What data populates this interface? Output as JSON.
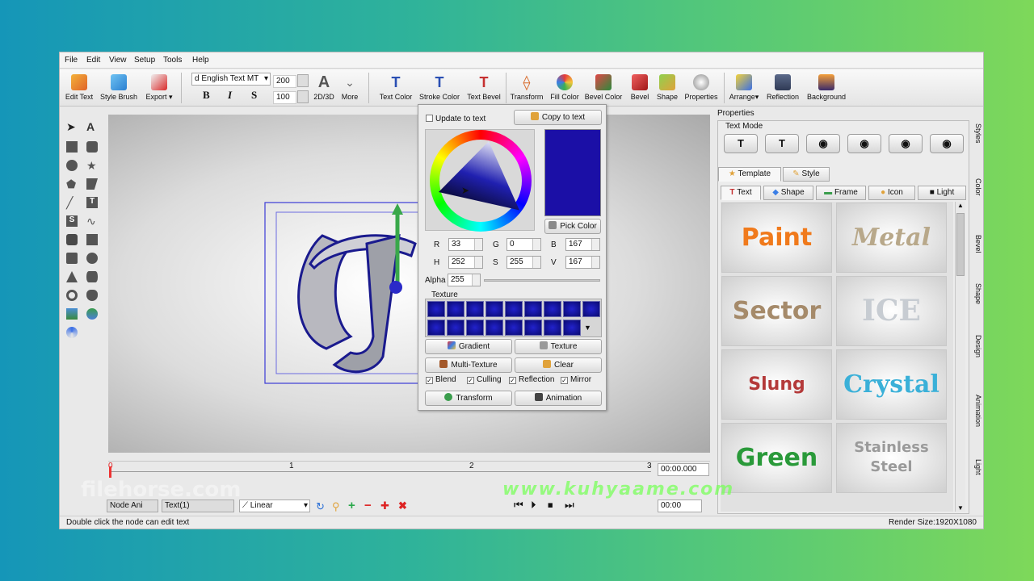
{
  "menu": [
    "File",
    "Edit",
    "View",
    "Setup",
    "Tools",
    "Help"
  ],
  "toolbar": {
    "left_buttons": [
      "Edit Text",
      "Style Brush",
      "Export"
    ],
    "font_name": "d English Text MT",
    "font_size": "200",
    "font_scale": "100",
    "mode_2d3d": "2D/3D",
    "more": "More",
    "bold": "B",
    "italic": "I",
    "strike": "S",
    "big_a": "A",
    "right_buttons": [
      "Text Color",
      "Stroke Color",
      "Text Bevel",
      "Transform",
      "Fill Color",
      "Bevel Color",
      "Bevel",
      "Shape",
      "Properties",
      "Arrange",
      "Reflection",
      "Background"
    ]
  },
  "color_popup": {
    "update_to_text": "Update to text",
    "copy_to_text": "Copy to text",
    "pick_color": "Pick Color",
    "current_color": "#1b0fa6",
    "r_label": "R",
    "r": "33",
    "g_label": "G",
    "g": "0",
    "b_label": "B",
    "b": "167",
    "h_label": "H",
    "h": "252",
    "s_label": "S",
    "s": "255",
    "v_label": "V",
    "v": "167",
    "alpha_label": "Alpha",
    "alpha": "255",
    "texture_label": "Texture",
    "gradient": "Gradient",
    "texture_btn": "Texture",
    "multi_texture": "Multi-Texture",
    "clear": "Clear",
    "blend": "Blend",
    "culling": "Culling",
    "reflection": "Reflection",
    "mirror": "Mirror",
    "transform": "Transform",
    "animation": "Animation"
  },
  "timeline": {
    "ticks": [
      "0",
      "1",
      "2",
      "3"
    ],
    "time": "00:00.000",
    "time2": "00:00"
  },
  "bottombar": {
    "node": "Node Ani",
    "text": "Text(1)",
    "interp": "Linear"
  },
  "status": {
    "left": "Double click the node can edit text",
    "right": "Render Size:1920X1080"
  },
  "properties": {
    "title": "Properties",
    "text_mode": "Text Mode",
    "tabs": [
      "Template",
      "Style"
    ],
    "subtabs": [
      "Text",
      "Shape",
      "Frame",
      "Icon",
      "Light"
    ],
    "thumbs": [
      "Paint",
      "Metal",
      "Sector",
      "ICE",
      "Slung",
      "Crystal",
      "Green",
      "Stainless Steel"
    ]
  },
  "sidetabs": [
    "Styles",
    "Color",
    "Bevel",
    "Shape",
    "Design",
    "Animation",
    "Light"
  ],
  "watermarks": {
    "filehorse": "filehorse.com",
    "kuhyaame": "www.kuhyaame.com"
  }
}
